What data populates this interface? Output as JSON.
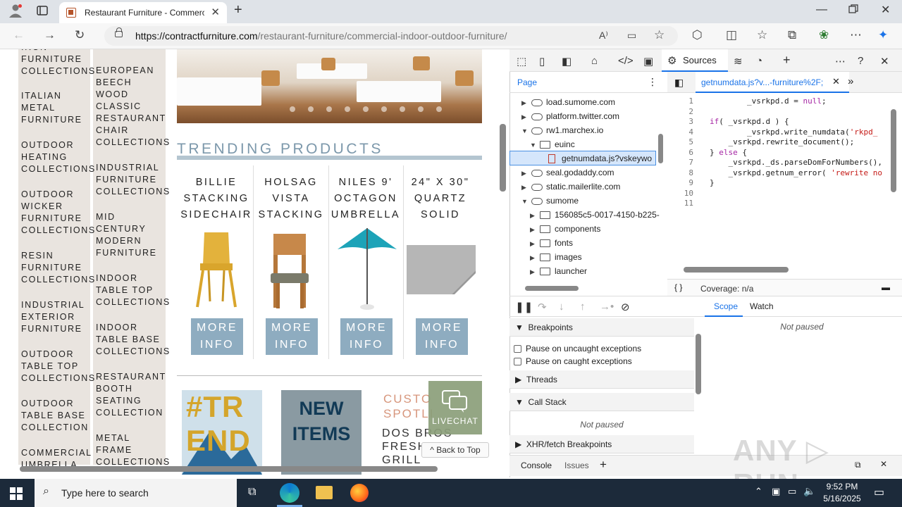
{
  "browser": {
    "tab_title": "Restaurant Furniture - Commercial",
    "url_host": "https://contractfurniture.com",
    "url_path": "/restaurant-furniture/commercial-indoor-outdoor-furniture/"
  },
  "page": {
    "collections_col1": [
      "IRON\nFURNITURE\nCOLLECTIONS",
      "ITALIAN\nMETAL\nFURNITURE",
      "OUTDOOR\nHEATING\nCOLLECTIONS",
      "OUTDOOR\nWICKER\nFURNITURE\nCOLLECTIONS",
      "RESIN\nFURNITURE\nCOLLECTIONS",
      "INDUSTRIAL\nEXTERIOR\nFURNITURE",
      "OUTDOOR\nTABLE TOP\nCOLLECTIONS",
      "OUTDOOR\nTABLE BASE\nCOLLECTION",
      "COMMERCIAL\nUMBRELLA"
    ],
    "collections_col2": [
      "EUROPEAN\nBEECH\nWOOD\nCLASSIC\nRESTAURANT\nCHAIR\nCOLLECTIONS",
      "INDUSTRIAL\nFURNITURE\nCOLLECTIONS",
      "MID\nCENTURY\nMODERN\nFURNITURE",
      "INDOOR\nTABLE TOP\nCOLLECTIONS",
      "INDOOR\nTABLE BASE\nCOLLECTIONS",
      "RESTAURANT\nBOOTH\nSEATING\nCOLLECTION",
      "METAL\nFRAME\nCOLLECTIONS"
    ],
    "trending_heading": "TRENDING PRODUCTS",
    "products": [
      {
        "name": "BILLIE\nSTACKING\nSIDECHAIR",
        "button": "MORE\nINFO"
      },
      {
        "name": "HOLSAG\nVISTA\nSTACKING",
        "button": "MORE\nINFO"
      },
      {
        "name": "NILES 9'\nOCTAGON\nUMBRELLA",
        "button": "MORE\nINFO"
      },
      {
        "name": "24\" X 30\"\nQUARTZ\nSOLID",
        "button": "MORE\nINFO"
      }
    ],
    "promo_trend": "#TR\nEND",
    "promo_new_items": "NEW\nITEMS",
    "promo_custom_title": "CUSTO\nSPOTLI",
    "promo_custom_text": "DOS BROS\nFRESH\nGRILL",
    "livechat": "LIVECHAT",
    "back_to_top": "^ Back to Top"
  },
  "devtools": {
    "sources_tab": "Sources",
    "page_tab": "Page",
    "tree": [
      {
        "label": "load.sumome.com",
        "type": "cloud",
        "level": 0,
        "arrow": "▶"
      },
      {
        "label": "platform.twitter.com",
        "type": "cloud",
        "level": 0,
        "arrow": "▶"
      },
      {
        "label": "rw1.marchex.io",
        "type": "cloud",
        "level": 0,
        "arrow": "▼"
      },
      {
        "label": "euinc",
        "type": "folder",
        "level": 1,
        "arrow": "▼"
      },
      {
        "label": "getnumdata.js?vskeywo",
        "type": "file",
        "level": 2,
        "arrow": ""
      },
      {
        "label": "seal.godaddy.com",
        "type": "cloud",
        "level": 0,
        "arrow": "▶"
      },
      {
        "label": "static.mailerlite.com",
        "type": "cloud",
        "level": 0,
        "arrow": "▶"
      },
      {
        "label": "sumome",
        "type": "cloud",
        "level": 0,
        "arrow": "▼"
      },
      {
        "label": "156085c5-0017-4150-b225-",
        "type": "folder",
        "level": 1,
        "arrow": "▶"
      },
      {
        "label": "components",
        "type": "folder",
        "level": 1,
        "arrow": "▶"
      },
      {
        "label": "fonts",
        "type": "folder",
        "level": 1,
        "arrow": "▶"
      },
      {
        "label": "images",
        "type": "folder",
        "level": 1,
        "arrow": "▶"
      },
      {
        "label": "launcher",
        "type": "folder",
        "level": 1,
        "arrow": "▶"
      }
    ],
    "file_tab": "getnumdata.js?v...-furniture%2F;",
    "code_lines": [
      "        _vsrkpd.d = null;",
      "",
      "if( _vsrkpd.d ) {",
      "        _vsrkpd.write_numdata('rkpd_",
      "    _vsrkpd.rewrite_document();",
      "} else {",
      "    _vsrkpd._ds.parseDomForNumbers(),",
      "    _vsrkpd.getnum_error( 'rewrite no",
      "}",
      "",
      ""
    ],
    "coverage": "Coverage: n/a",
    "breakpoints": "Breakpoints",
    "pause_uncaught": "Pause on uncaught exceptions",
    "pause_caught": "Pause on caught exceptions",
    "threads": "Threads",
    "call_stack": "Call Stack",
    "not_paused": "Not paused",
    "xhr_breakpoints": "XHR/fetch Breakpoints",
    "scope_tab": "Scope",
    "watch_tab": "Watch",
    "console_tab": "Console",
    "issues_tab": "Issues"
  },
  "taskbar": {
    "search_placeholder": "Type here to search",
    "time": "9:52 PM",
    "date": "5/16/2025"
  },
  "colors": {
    "accent_blue": "#1a73e8",
    "button_blue": "#8eacc0",
    "sidebar_bg": "#e9e4df"
  }
}
